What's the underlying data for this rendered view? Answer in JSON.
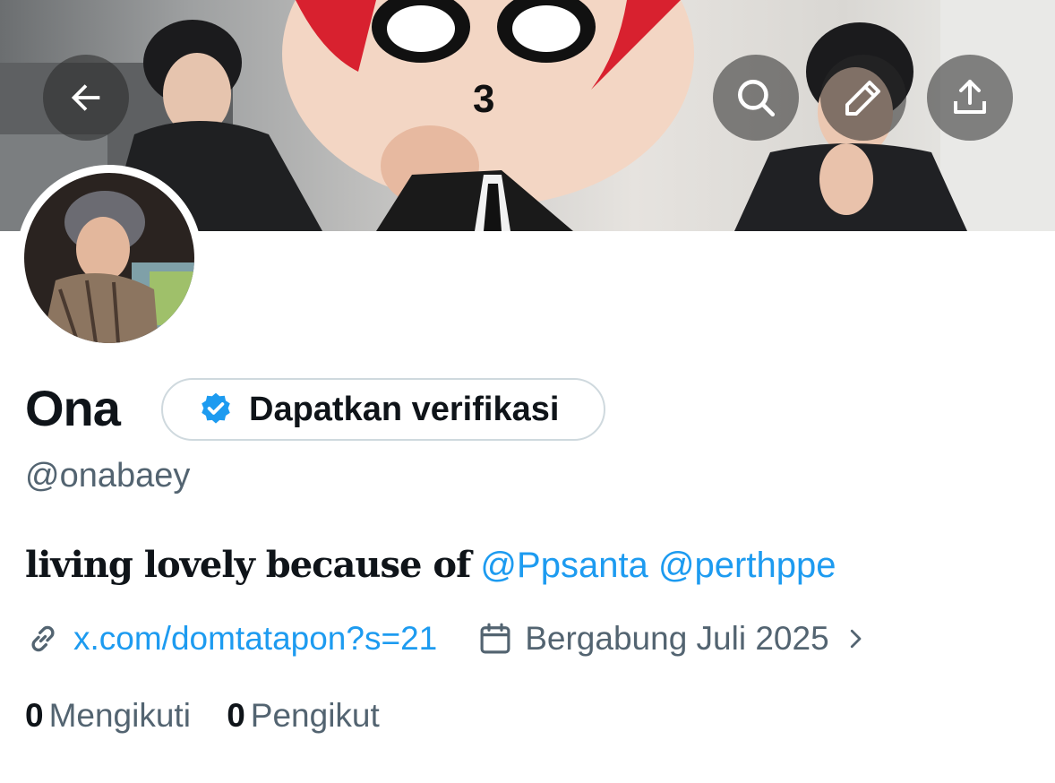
{
  "header": {
    "back_icon": "arrow-left-icon",
    "search_icon": "search-icon",
    "edit_icon": "pencil-icon",
    "share_icon": "share-upload-icon",
    "banner_mascot_text": "3"
  },
  "profile": {
    "name": "Ona",
    "verify_button_label": "Dapatkan verifikasi",
    "handle": "@onabaey",
    "bio": {
      "text": "living lovely because of",
      "mentions": [
        "@Ppsanta",
        "@perthppe"
      ]
    },
    "website": "x.com/domtatapon?s=21",
    "joined": "Bergabung Juli 2025",
    "following_count": "0",
    "following_label": "Mengikuti",
    "followers_count": "0",
    "followers_label": "Pengikut"
  },
  "colors": {
    "accent": "#1d9bf0",
    "text_primary": "#0f1419",
    "text_secondary": "#536471",
    "border": "#cfd9de"
  }
}
